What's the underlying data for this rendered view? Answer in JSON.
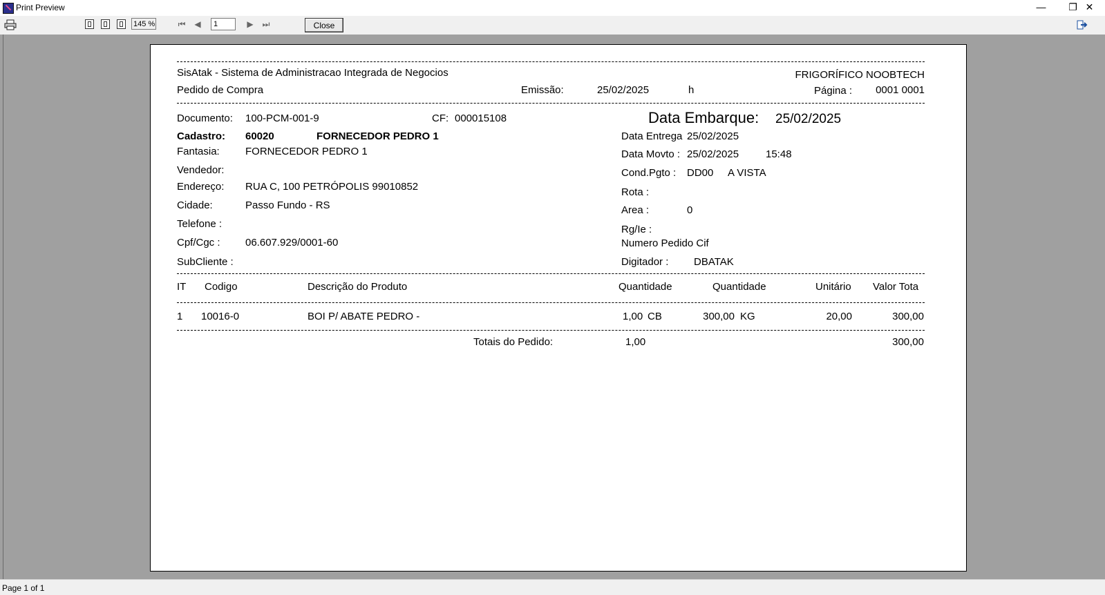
{
  "window": {
    "title": "Print Preview",
    "minimize_glyph": "—",
    "restore_glyph": "❐",
    "close_glyph": "✕"
  },
  "toolbar": {
    "print_icon": "printer-icon",
    "zoom": "145 %",
    "page_number": "1",
    "close_label": "Close",
    "first_glyph": "⏮",
    "prev_glyph": "◀",
    "next_glyph": "▶",
    "last_glyph": "⏭"
  },
  "report": {
    "header": {
      "system_name": "SisAtak - Sistema de Administracao Integrada de Negocios",
      "company": "FRIGORÍFICO NOOBTECH",
      "doc_type": "Pedido de Compra",
      "emissao_label": "Emissão:",
      "emissao_value": "25/02/2025",
      "hora_label": "h",
      "pagina_label": "Página :",
      "pagina_value": "0001 0001"
    },
    "left": {
      "documento_label": "Documento:",
      "documento_value": "100-PCM-001-9",
      "cf_label": "CF:",
      "cf_value": "000015108",
      "cadastro_label": "Cadastro:",
      "cadastro_code": "60020",
      "cadastro_name": "FORNECEDOR PEDRO 1",
      "fantasia_label": "Fantasia:",
      "fantasia_value": "FORNECEDOR PEDRO 1",
      "vendedor_label": "Vendedor:",
      "endereco_label": "Endereço:",
      "endereco_value": "RUA C, 100 PETRÓPOLIS 99010852",
      "cidade_label": "Cidade:",
      "cidade_value": "Passo Fundo - RS",
      "telefone_label": "Telefone :",
      "cpf_label": "Cpf/Cgc :",
      "cpf_value": "06.607.929/0001-60",
      "subcliente_label": "SubCliente :"
    },
    "right": {
      "embarque_label": "Data Embarque:",
      "embarque_value": "25/02/2025",
      "entrega_label": "Data Entrega",
      "entrega_value": "25/02/2025",
      "movto_label": "Data Movto :",
      "movto_value": "25/02/2025",
      "movto_time": "15:48",
      "condpgto_label": "Cond.Pgto :",
      "condpgto_code": "DD00",
      "condpgto_desc": "A VISTA",
      "rota_label": "Rota :",
      "area_label": "Area :",
      "area_value": "0",
      "rgie_label": "Rg/Ie :",
      "numero_cif_label": "Numero Pedido Cif",
      "digitador_label": "Digitador :",
      "digitador_value": "DBATAK"
    },
    "table": {
      "headers": {
        "it": "IT",
        "codigo": "Codigo",
        "descricao": "Descrição do Produto",
        "quantidade1": "Quantidade",
        "quantidade2": "Quantidade",
        "unitario": "Unitário",
        "valor_total": "Valor Tota"
      },
      "rows": [
        {
          "it": "1",
          "codigo": "10016-0",
          "descricao": "BOI P/ ABATE PEDRO -",
          "qtd1": "1,00",
          "un1": "CB",
          "qtd2": "300,00",
          "un2": "KG",
          "unitario": "20,00",
          "valor_total": "300,00"
        }
      ],
      "totals_label": "Totais do Pedido:",
      "totals_qtd": "1,00",
      "totals_valor": "300,00"
    }
  },
  "status": {
    "page_info": "Page 1 of 1"
  }
}
